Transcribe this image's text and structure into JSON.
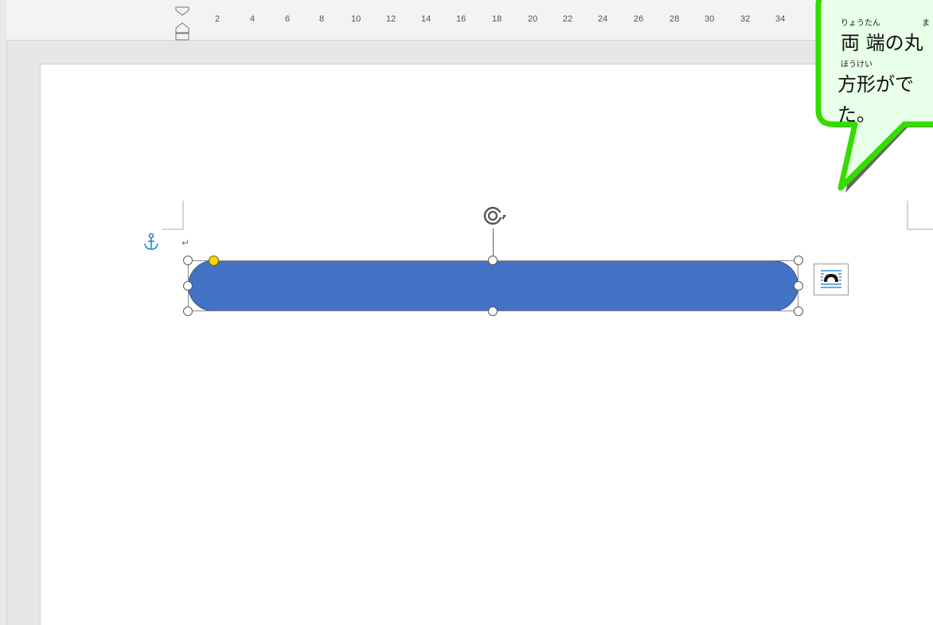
{
  "ruler": {
    "numbers": [
      "2",
      "4",
      "6",
      "8",
      "10",
      "12",
      "14",
      "16",
      "18",
      "20",
      "22",
      "24",
      "26",
      "28",
      "30",
      "32",
      "34"
    ]
  },
  "document": {
    "paragraph_mark": "↵"
  },
  "shape": {
    "fill_color": "#4472c4",
    "kind": "rounded-rectangle"
  },
  "callout": {
    "line1_ruby": [
      "りょうたん",
      "ま"
    ],
    "line1_text": "両 端の丸",
    "line2_ruby": "ほうけい",
    "line2_text": "方形がで",
    "line3_text": "た。",
    "border_color": "#33dd00",
    "fill_color": "#e8ffe8"
  }
}
